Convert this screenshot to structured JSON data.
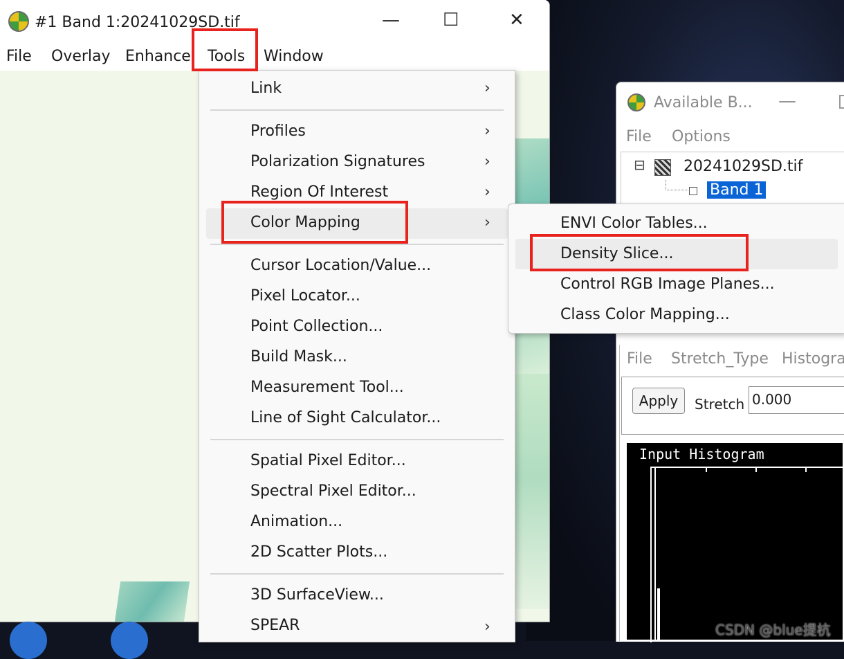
{
  "main_window": {
    "title": "#1 Band 1:20241029SD.tif",
    "controls": {
      "minimize": "—",
      "maximize": "☐",
      "close": "✕"
    },
    "menu": [
      "File",
      "Overlay",
      "Enhance",
      "Tools",
      "Window"
    ]
  },
  "tools_menu": {
    "items": [
      {
        "label": "Link",
        "submenu": true
      },
      {
        "label": "Profiles",
        "submenu": true
      },
      {
        "label": "Polarization Signatures",
        "submenu": true
      },
      {
        "label": "Region Of Interest",
        "submenu": true
      },
      {
        "label": "Color Mapping",
        "submenu": true
      },
      {
        "label": "Cursor Location/Value...",
        "submenu": false
      },
      {
        "label": "Pixel Locator...",
        "submenu": false
      },
      {
        "label": "Point Collection...",
        "submenu": false
      },
      {
        "label": "Build Mask...",
        "submenu": false
      },
      {
        "label": "Measurement Tool...",
        "submenu": false
      },
      {
        "label": "Line of Sight Calculator...",
        "submenu": false
      },
      {
        "label": "Spatial Pixel Editor...",
        "submenu": false
      },
      {
        "label": "Spectral Pixel Editor...",
        "submenu": false
      },
      {
        "label": "Animation...",
        "submenu": false
      },
      {
        "label": "2D Scatter Plots...",
        "submenu": false
      },
      {
        "label": "3D SurfaceView...",
        "submenu": false
      },
      {
        "label": "SPEAR",
        "submenu": true
      }
    ],
    "chevron": "›"
  },
  "color_mapping_submenu": {
    "items": [
      "ENVI Color Tables...",
      "Density Slice...",
      "Control RGB Image Planes...",
      "Class Color Mapping..."
    ]
  },
  "bands_window": {
    "title": "Available B...",
    "minimize": "—",
    "menu": [
      "File",
      "Options"
    ],
    "tree": {
      "file": "20241029SD.tif",
      "band": "Band 1",
      "expander": "⊟"
    }
  },
  "histogram_window": {
    "menu": [
      "File",
      "Stretch_Type",
      "Histogra"
    ],
    "apply_label": "Apply",
    "stretch_label": "Stretch",
    "stretch_value": "0.000",
    "plot_title": "Input Histogram"
  },
  "watermark": "CSDN @blue提杭",
  "colors": {
    "highlight": "#e8231e",
    "selection": "#0a64d6",
    "image_bg": "#f1f8ea"
  }
}
